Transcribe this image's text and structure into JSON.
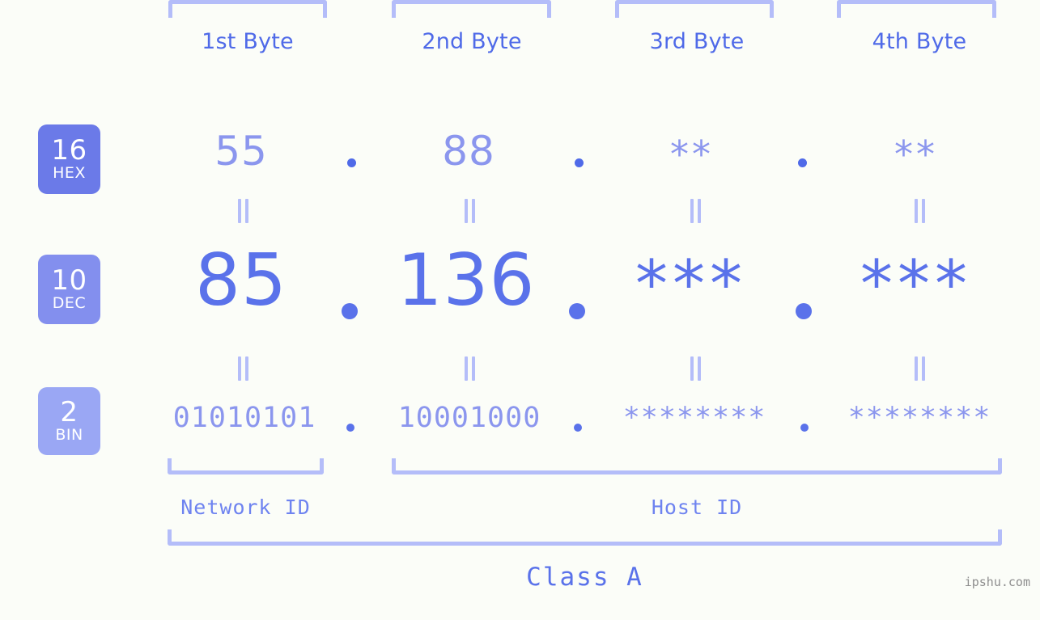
{
  "meta": {
    "background_color": "#fbfdf8",
    "accent_color": "#5a72ea",
    "light_accent_color": "#b4bdf9",
    "mid_accent_color": "#8b96ee",
    "watermark": "ipshu.com"
  },
  "headers": [
    {
      "label": "1st Byte"
    },
    {
      "label": "2nd Byte"
    },
    {
      "label": "3rd Byte"
    },
    {
      "label": "4th Byte"
    }
  ],
  "radix_badges": [
    {
      "number": "16",
      "name": "HEX",
      "color": "#6b7ae8"
    },
    {
      "number": "10",
      "name": "DEC",
      "color": "#838fee"
    },
    {
      "number": "2",
      "name": "BIN",
      "color": "#9aa7f4"
    }
  ],
  "rows": {
    "hex": {
      "octets": [
        "55",
        "88",
        "**",
        "**"
      ],
      "separators": [
        ".",
        ".",
        "."
      ]
    },
    "dec": {
      "octets": [
        "85",
        "136",
        "***",
        "***"
      ],
      "separators": [
        ".",
        ".",
        "."
      ]
    },
    "bin": {
      "octets": [
        "01010101",
        "10001000",
        "********",
        "********"
      ],
      "separators": [
        ".",
        ".",
        "."
      ]
    }
  },
  "equality_markers": {
    "glyph": "||",
    "count_row_hex_dec": 4,
    "count_row_dec_bin": 4
  },
  "id_labels": [
    {
      "label": "Network ID"
    },
    {
      "label": "Host ID"
    }
  ],
  "class_label": "Class A"
}
